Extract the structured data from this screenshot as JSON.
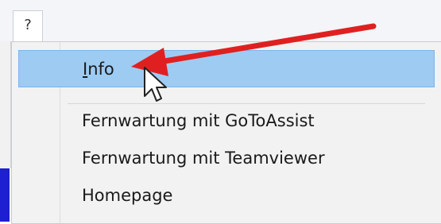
{
  "menubar": {
    "help_label": "?"
  },
  "menu": {
    "items": [
      {
        "mnemonic": "I",
        "rest": "nfo",
        "highlighted": true
      },
      {
        "label": "Fernwartung mit GoToAssist"
      },
      {
        "label": "Fernwartung mit Teamviewer"
      },
      {
        "label": "Homepage"
      }
    ]
  },
  "annotation": {
    "arrow_color": "#e02020",
    "arrow_icon": "red-arrow-icon"
  },
  "colors": {
    "highlight": "#9ecbf2",
    "menu_background": "#f2f2f2",
    "left_edge_blue": "#1d1fd0"
  }
}
